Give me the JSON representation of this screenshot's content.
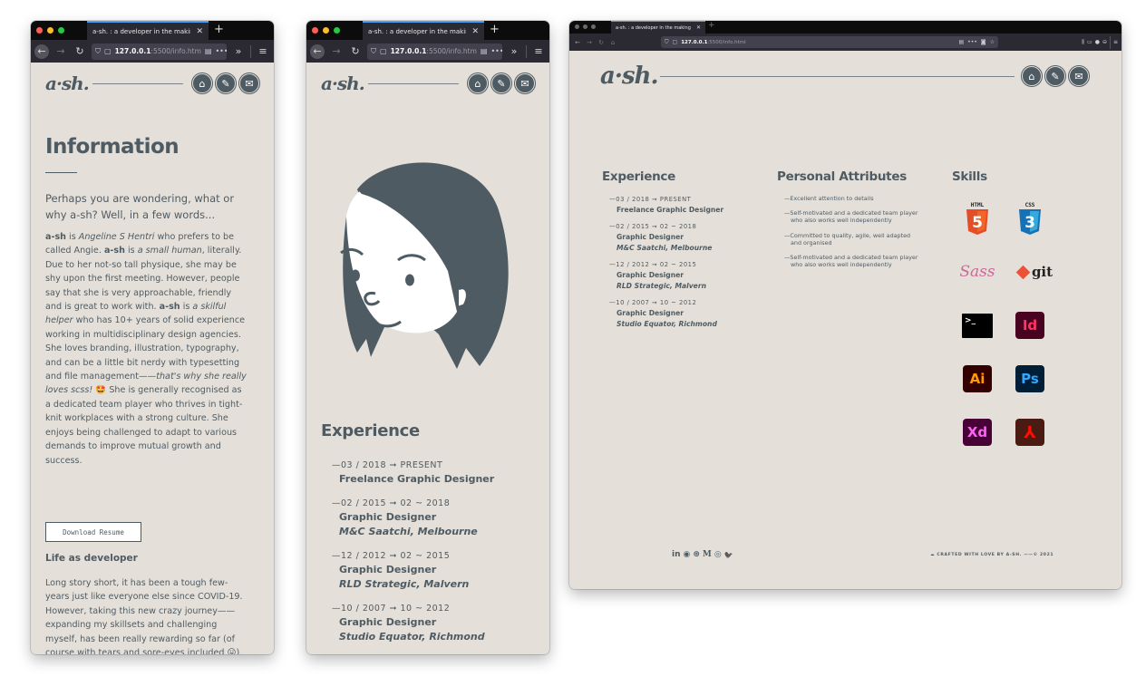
{
  "browser": {
    "tab_title": "a-sh. : a developer in the making",
    "url_host": "127.0.0.1",
    "url_path_short": ":5500/info.htm",
    "url_path_full": ":5500/info.html",
    "new_tab": "+",
    "tab_close": "✕"
  },
  "site": {
    "logo": "a·sh.",
    "nav": [
      {
        "name": "home",
        "glyph": "⌂"
      },
      {
        "name": "journal",
        "glyph": "✎"
      },
      {
        "name": "contact",
        "glyph": "✉"
      }
    ]
  },
  "info": {
    "title": "Information",
    "lead": "Perhaps you are wondering, what or why a-sh? Well, in a few words...",
    "bio": {
      "p1_a": "a-sh",
      "p1_b": " is ",
      "p1_c": "Angeline S Hentri",
      "p1_d": " who prefers to be called Angie. ",
      "p1_e": "a-sh",
      "p1_f": " is ",
      "p1_g": "a small human",
      "p1_h": ", literally. Due to her not-so tall physique, she may be shy upon the first meeting. However, people say that she is very approachable, friendly and is great to work with. ",
      "p1_i": "a-sh",
      "p1_j": " is ",
      "p1_k": "a skilful helper",
      "p1_l": " who has 10+ years of solid experience working in multidisciplinary design agencies. She loves branding, illustration, typography, and can be a little bit nerdy with typesetting and file management——",
      "p1_m": "that's why she really loves scss!",
      "p1_n": " 🤩 She is generally recognised as a dedicated team player who thrives in tight-knit workplaces with a strong culture. She enjoys being challenged to adapt to various demands to improve mutual growth and success."
    },
    "download_button": "Download Resume",
    "life_title": "Life as developer",
    "life_text": "Long story short, it has been a tough few-years just like everyone else since COVID-19. However, taking this new crazy journey——expanding my skillsets and challenging myself, has been really rewarding so far (of course with tears and sore-eyes included 😛). Follow my journey through my journal and let's connect!"
  },
  "experience": {
    "title": "Experience",
    "items": [
      {
        "date": "—03 / 2018 ➞ PRESENT",
        "role": "Freelance Graphic Designer",
        "company": ""
      },
      {
        "date": "—02 / 2015 ➞ 02 ~ 2018",
        "role": "Graphic Designer",
        "company": "M&C Saatchi, Melbourne"
      },
      {
        "date": "—12 / 2012 ➞ 02 ~ 2015",
        "role": "Graphic Designer",
        "company": "RLD Strategic, Malvern"
      },
      {
        "date": "—10 / 2007 ➞ 10 ~ 2012",
        "role": "Graphic Designer",
        "company": "Studio Equator, Richmond"
      }
    ]
  },
  "attributes": {
    "title": "Personal Attributes",
    "items": [
      "—Excellent attention to details",
      "—Self-motivated and a dedicated team player who also works well independently",
      "—Committed to quality, agile, well adapted and organised",
      "—Self-motivated and a dedicated team player who also works well independently"
    ]
  },
  "skills": {
    "title": "Skills",
    "items": [
      {
        "name": "html5",
        "label": "HTML",
        "glyph": "5",
        "color": "#e44d26"
      },
      {
        "name": "css3",
        "label": "CSS",
        "glyph": "3",
        "color": "#1572b6"
      },
      {
        "name": "sass",
        "label": "Sass",
        "color": "#cd6799"
      },
      {
        "name": "git",
        "label": "git",
        "color": "#f05033"
      },
      {
        "name": "terminal",
        "label": ">_",
        "color": "#000000"
      },
      {
        "name": "indesign",
        "label": "Id",
        "color": "#ff3366",
        "bg": "#49021f"
      },
      {
        "name": "illustrator",
        "label": "Ai",
        "color": "#ff9a00",
        "bg": "#330000"
      },
      {
        "name": "photoshop",
        "label": "Ps",
        "color": "#31a8ff",
        "bg": "#001e36"
      },
      {
        "name": "xd",
        "label": "Xd",
        "color": "#ff61f6",
        "bg": "#470137"
      },
      {
        "name": "acrobat",
        "label": "⅄",
        "color": "#fa0f00",
        "bg": "#4a1b12"
      }
    ]
  },
  "footer": {
    "social": [
      "in",
      "◉",
      "⊛",
      "M",
      "◎",
      "🐦"
    ],
    "social_names": [
      "linkedin",
      "github",
      "codepen",
      "medium",
      "instagram",
      "twitter"
    ],
    "credit": "☁ CRAFTED WITH LOVE BY A-SH. ——© 2021"
  },
  "colors": {
    "page_bg": "#e4e0d9",
    "ink": "#4f5b63",
    "chrome_dark": "#0c0c0d",
    "chrome_toolbar": "#2b2a33",
    "tab_accent": "#4a9ff5"
  }
}
